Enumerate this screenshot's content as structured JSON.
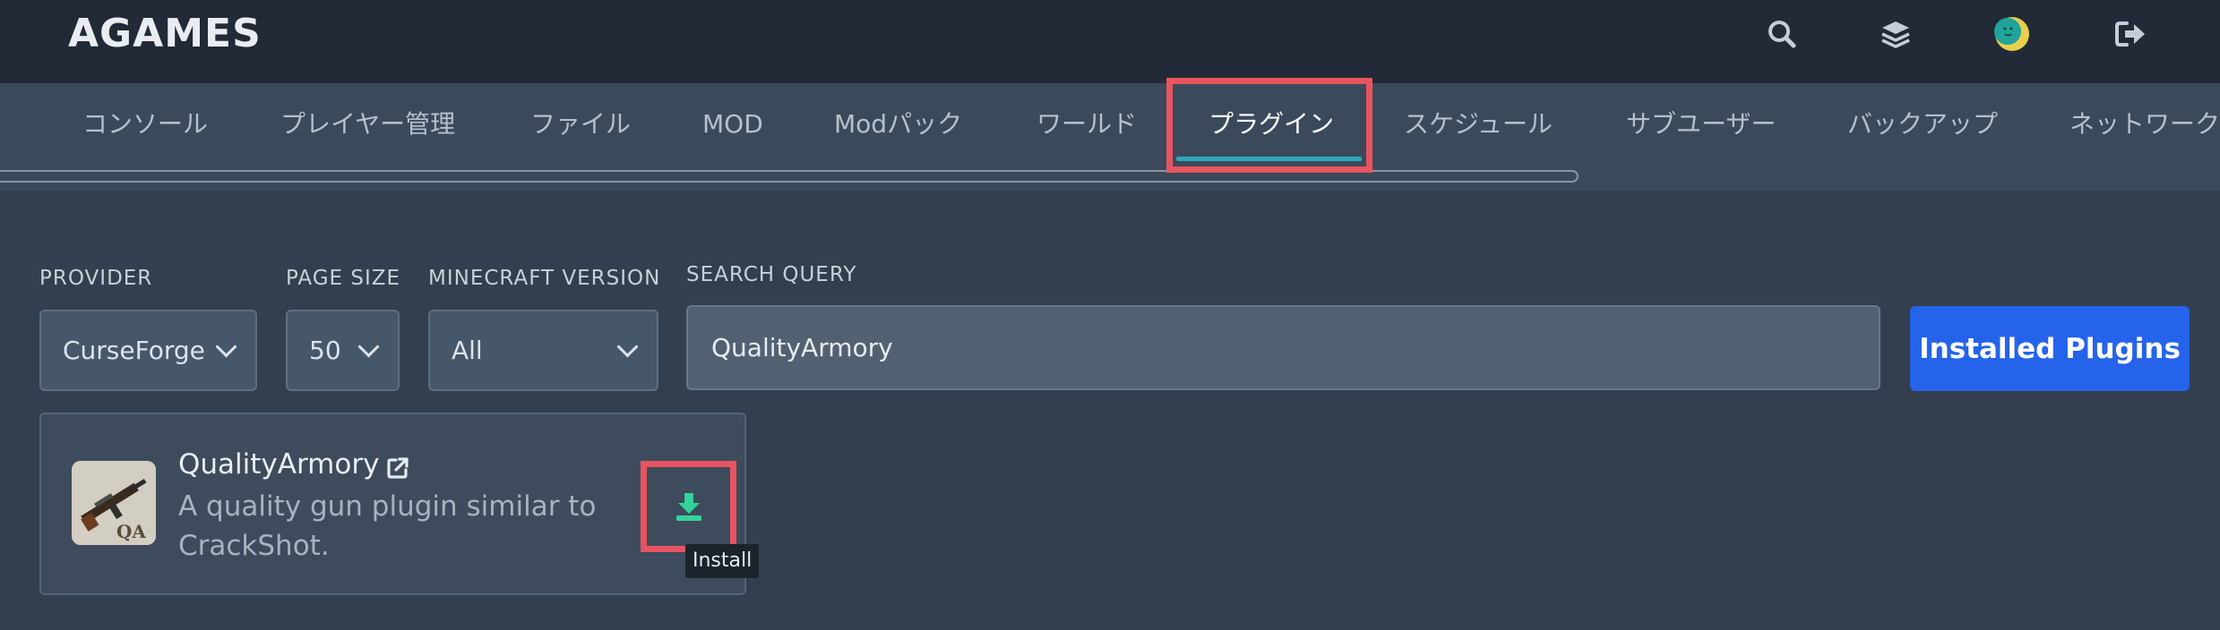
{
  "app": {
    "brand": "AGAMES"
  },
  "top_icons": [
    "search-icon",
    "layers-icon",
    "avatar",
    "logout-icon"
  ],
  "tabs": [
    {
      "label": "コンソール",
      "active": false
    },
    {
      "label": "プレイヤー管理",
      "active": false
    },
    {
      "label": "ファイル",
      "active": false
    },
    {
      "label": "MOD",
      "active": false
    },
    {
      "label": "Modパック",
      "active": false
    },
    {
      "label": "ワールド",
      "active": false
    },
    {
      "label": "プラグイン",
      "active": true
    },
    {
      "label": "スケジュール",
      "active": false
    },
    {
      "label": "サブユーザー",
      "active": false
    },
    {
      "label": "バックアップ",
      "active": false
    },
    {
      "label": "ネットワーク",
      "active": false
    }
  ],
  "filters": {
    "provider": {
      "label": "PROVIDER",
      "value": "CurseForge"
    },
    "page_size": {
      "label": "PAGE SIZE",
      "value": "50"
    },
    "minecraft_version": {
      "label": "MINECRAFT VERSION",
      "value": "All"
    },
    "search": {
      "label": "SEARCH QUERY",
      "value": "QualityArmory"
    }
  },
  "installed_plugins_button": "Installed Plugins",
  "result": {
    "name": "QualityArmory",
    "description": "A quality gun plugin similar to CrackShot.",
    "thumb_text": "QA",
    "install_tooltip": "Install"
  },
  "colors": {
    "accent": "#2563eb",
    "highlight": "#e8545f",
    "tab_underline": "#2ea7b9",
    "install_icon": "#34d399"
  }
}
